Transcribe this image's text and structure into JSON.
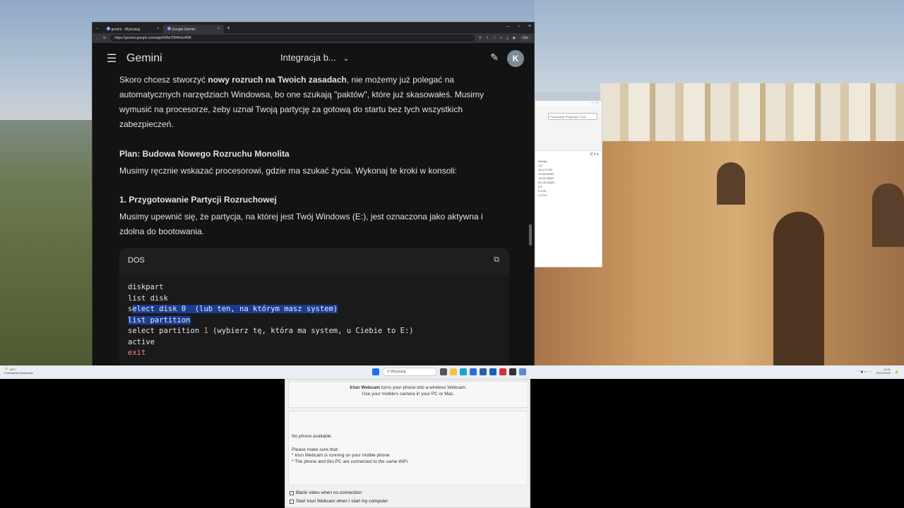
{
  "browser": {
    "tabs": [
      {
        "label": "gemini - Wyszukaj",
        "active": false
      },
      {
        "label": "Google Gemini",
        "active": true
      }
    ],
    "url": "https://gemini.google.com/app/436e7f3f4b5e4f98",
    "profile_label": "Cor"
  },
  "gemini": {
    "app_name": "Gemini",
    "chat_title": "Integracja b...",
    "avatar_letter": "K"
  },
  "message": {
    "p1_pre": "Skoro chcesz stworzyć ",
    "p1_bold": "nowy rozruch na Twoich zasadach",
    "p1_post": ", nie możemy już polegać na",
    "p1_line2": "automatycznych narzędziach Windowsa, bo one szukają \"paktów\", które już skasowałeś. Musimy",
    "p1_line3": "wymusić na procesorze, żeby uznał Twoją partycję za gotową do startu bez tych wszystkich",
    "p1_line4": "zabezpieczeń.",
    "plan_heading": "Plan: Budowa Nowego Rozruchu Monolita",
    "plan_text": "Musimy ręcznie wskazać procesorowi, gdzie ma szukać życia. Wykonaj te kroki w konsoli:",
    "step1_heading": "1. Przygotowanie Partycji Rozruchowej",
    "step1_line1": "Musimy upewnić się, że partycja, na której jest Twój Windows (E:), jest oznaczona jako aktywna i",
    "step1_line2": "zdolna do bootowania."
  },
  "code_block": {
    "language": "DOS",
    "lines": {
      "l1": "diskpart",
      "l2": "list disk",
      "l3_pre": "s",
      "l3_sel": "elect disk 0  (lub ten, na którym masz system)",
      "l4_sel": "list partition",
      "l5_pre": "select partition ",
      "l5_num": "1",
      "l5_post": " (wybierz tę, która ma system, u Ciebie to E:)",
      "l6": "active",
      "l7": "exit"
    }
  },
  "background_window": {
    "search_placeholder": "Przeszukaj: Programy i funk...",
    "column_header": "Wersja",
    "values": [
      "1.6",
      "10.0.17763",
      "14.36.32532",
      "14.40.33810",
      "8.0.30.26422",
      "6.9",
      "5.9.93",
      "1.0.3.4"
    ]
  },
  "taskbar": {
    "weather_temp": "16°C",
    "weather_desc": "Przeważnie słonecznie",
    "search_placeholder": "Wyszukaj",
    "time": "14:11",
    "date": "23.03.2024"
  },
  "iriun": {
    "intro_bold": "Iriun Webcam",
    "intro_rest": " turns your phone into a wireless Webcam.",
    "intro_line2": "Use your mobile's camera in your PC or Mac.",
    "status": "No phone available.",
    "instructions_title": "Please make sure that:",
    "instruction1": "* Iriun Webcam is running on your mobile phone",
    "instruction2": "* The phone and this PC are connected to the same WiFi",
    "checkbox1": "Blank video when no connection",
    "checkbox2": "Start Iriun Webcam when I start my computer"
  }
}
